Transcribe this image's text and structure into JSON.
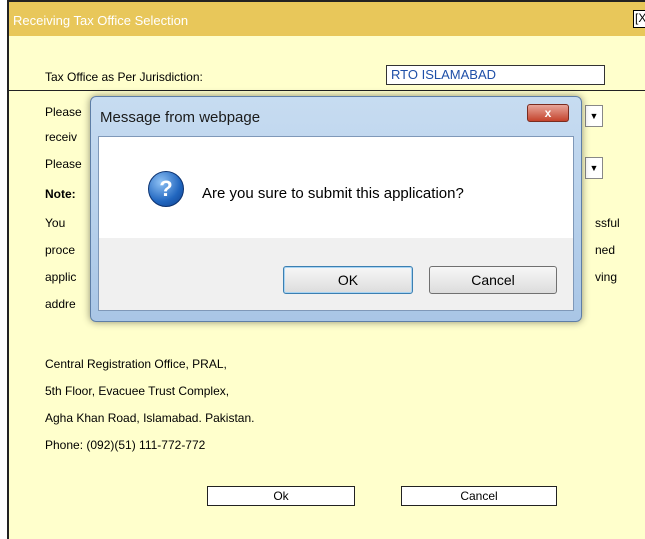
{
  "window": {
    "title": "Receiving Tax Office Selection",
    "close_label": "[X"
  },
  "jurisdiction": {
    "label": "Tax Office as Per Jurisdiction:",
    "value": "RTO ISLAMABAD"
  },
  "partial_text": {
    "please1": "Please",
    "receiv": "receiv",
    "please2": "Please",
    "note": "Note:",
    "you": "You",
    "proce": "proce",
    "applic": "applic",
    "addre": "addre",
    "ssful": "ssful",
    "ned": "ned",
    "ving": "ving"
  },
  "address": {
    "line1": "Central Registration Office, PRAL,",
    "line2": "5th Floor, Evacuee Trust Complex,",
    "line3": "Agha Khan Road, Islamabad. Pakistan.",
    "line4": "Phone: (092)(51) 111-772-772"
  },
  "buttons": {
    "ok": "Ok",
    "cancel": "Cancel"
  },
  "dialog": {
    "title": "Message from webpage",
    "close_glyph": "x",
    "message": "Are you sure to submit this application?",
    "ok": "OK",
    "cancel": "Cancel",
    "icon": "question-icon"
  },
  "colors": {
    "title_bar": "#e8c75a",
    "panel_bg": "#ffffcc",
    "link_value": "#1e4fa8"
  }
}
